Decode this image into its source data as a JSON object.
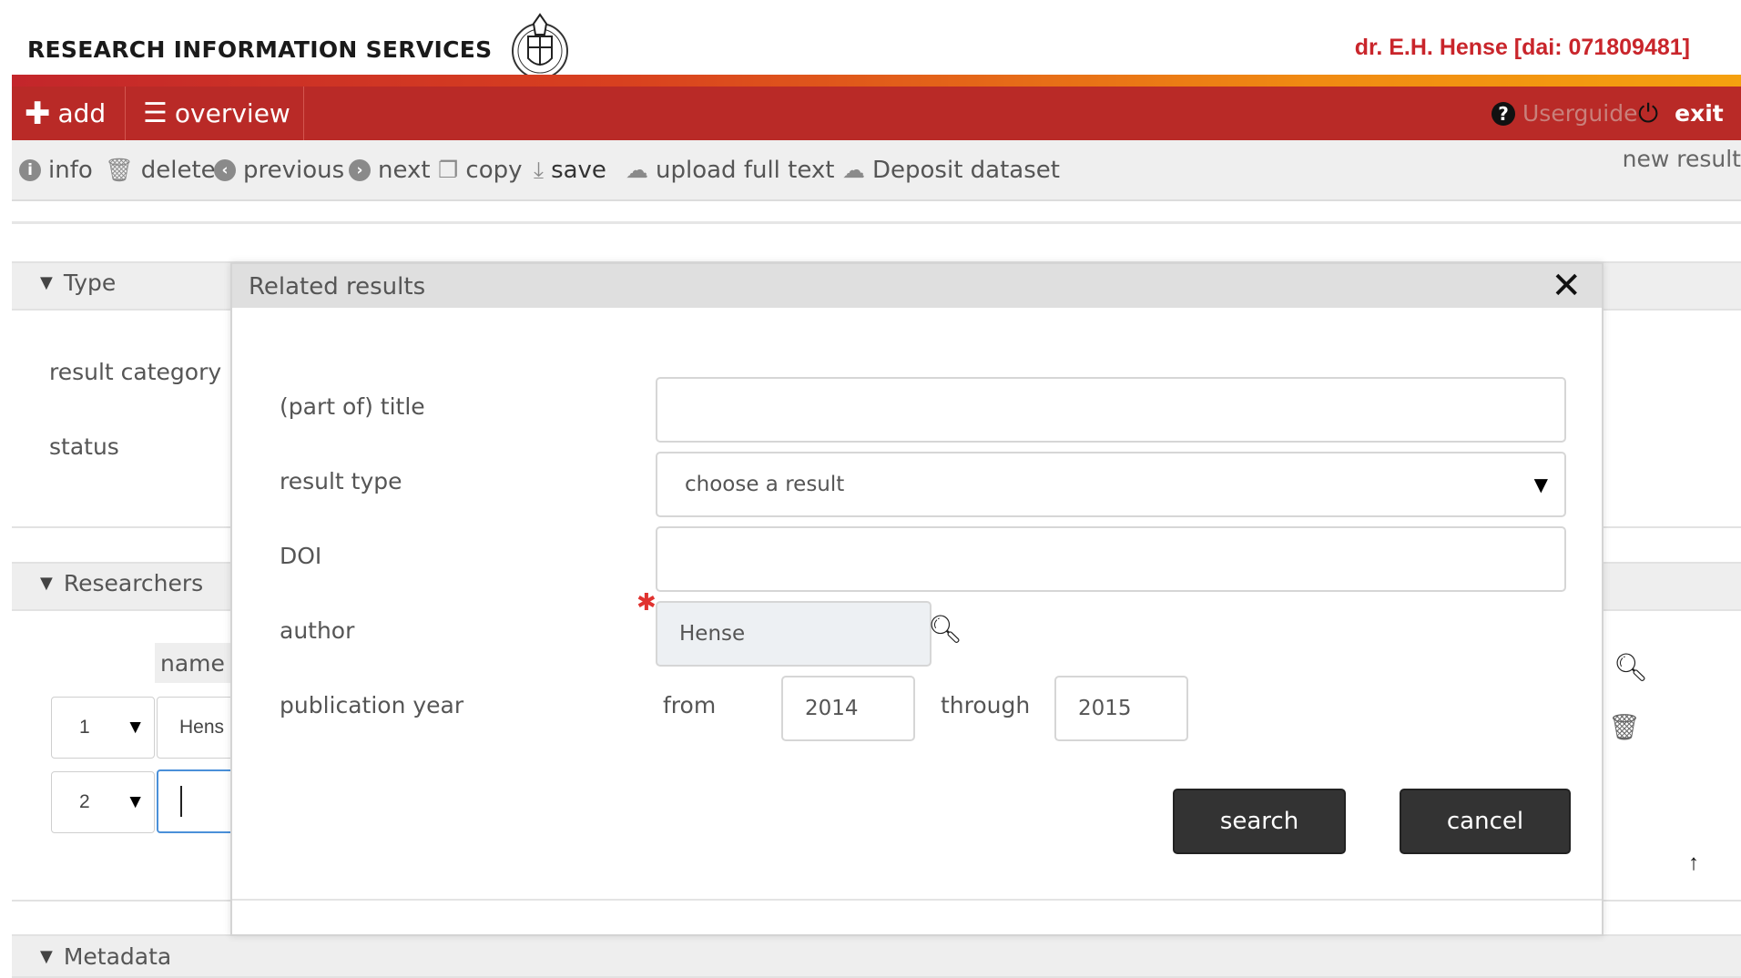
{
  "header": {
    "brand": "RESEARCH INFORMATION SERVICES",
    "user": "dr. E.H. Hense [dai: 071809481]"
  },
  "nav": {
    "add": "add",
    "overview": "overview",
    "userguide": "Userguide",
    "exit": "exit"
  },
  "toolbar": {
    "info": "info",
    "delete": "delete",
    "previous": "previous",
    "next": "next",
    "copy": "copy",
    "save": "save",
    "upload": "upload full text",
    "deposit": "Deposit dataset",
    "new_result": "new result"
  },
  "sections": {
    "type": {
      "title": "Type",
      "result_category": "result category",
      "status": "status"
    },
    "researchers": {
      "title": "Researchers",
      "name_header": "name",
      "rows": [
        {
          "order": "1",
          "name": "Hens"
        },
        {
          "order": "2",
          "name": ""
        }
      ]
    },
    "metadata": {
      "title": "Metadata"
    }
  },
  "modal": {
    "title": "Related results",
    "fields": {
      "title_label": "(part of) title",
      "title_value": "",
      "result_type_label": "result type",
      "result_type_value": "choose a result",
      "doi_label": "DOI",
      "doi_value": "",
      "author_label": "author",
      "author_value": "Hense",
      "year_label": "publication year",
      "from_label": "from",
      "from_value": "2014",
      "through_label": "through",
      "through_value": "2015"
    },
    "search_button": "search",
    "cancel_button": "cancel"
  },
  "colors": {
    "nav_red": "#b92a27",
    "user_red": "#c9252b",
    "button_dark": "#333333"
  }
}
